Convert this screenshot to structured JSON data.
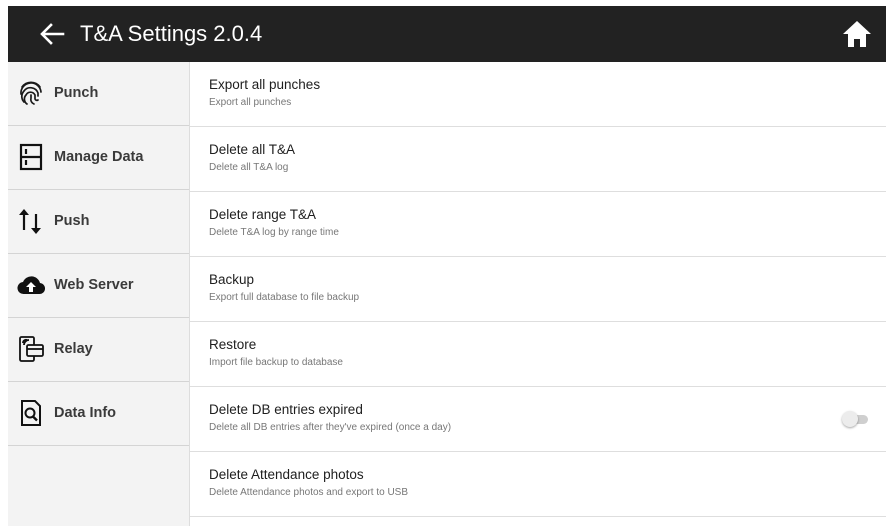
{
  "header": {
    "title": "T&A Settings 2.0.4",
    "back_icon": "arrow-left-icon",
    "home_icon": "home-icon",
    "background": "#222222"
  },
  "sidebar": {
    "items": [
      {
        "label": "Punch",
        "icon": "fingerprint-icon"
      },
      {
        "label": "Manage Data",
        "icon": "cabinet-icon"
      },
      {
        "label": "Push",
        "icon": "up-down-arrows-icon"
      },
      {
        "label": "Web Server",
        "icon": "cloud-upload-icon"
      },
      {
        "label": "Relay",
        "icon": "relay-card-icon"
      },
      {
        "label": "Data Info",
        "icon": "document-search-icon"
      }
    ]
  },
  "settings": {
    "items": [
      {
        "title": "Export all punches",
        "subtitle": "Export all punches"
      },
      {
        "title": "Delete all T&A",
        "subtitle": "Delete all T&A log"
      },
      {
        "title": "Delete range T&A",
        "subtitle": "Delete T&A log by range time"
      },
      {
        "title": "Backup",
        "subtitle": "Export full database to file backup"
      },
      {
        "title": "Restore",
        "subtitle": "Import file backup to database"
      },
      {
        "title": "Delete DB entries expired",
        "subtitle": "Delete all DB entries after they've expired (once a day)",
        "toggle_on": false
      },
      {
        "title": "Delete Attendance photos",
        "subtitle": "Delete Attendance photos and export to USB"
      }
    ]
  }
}
